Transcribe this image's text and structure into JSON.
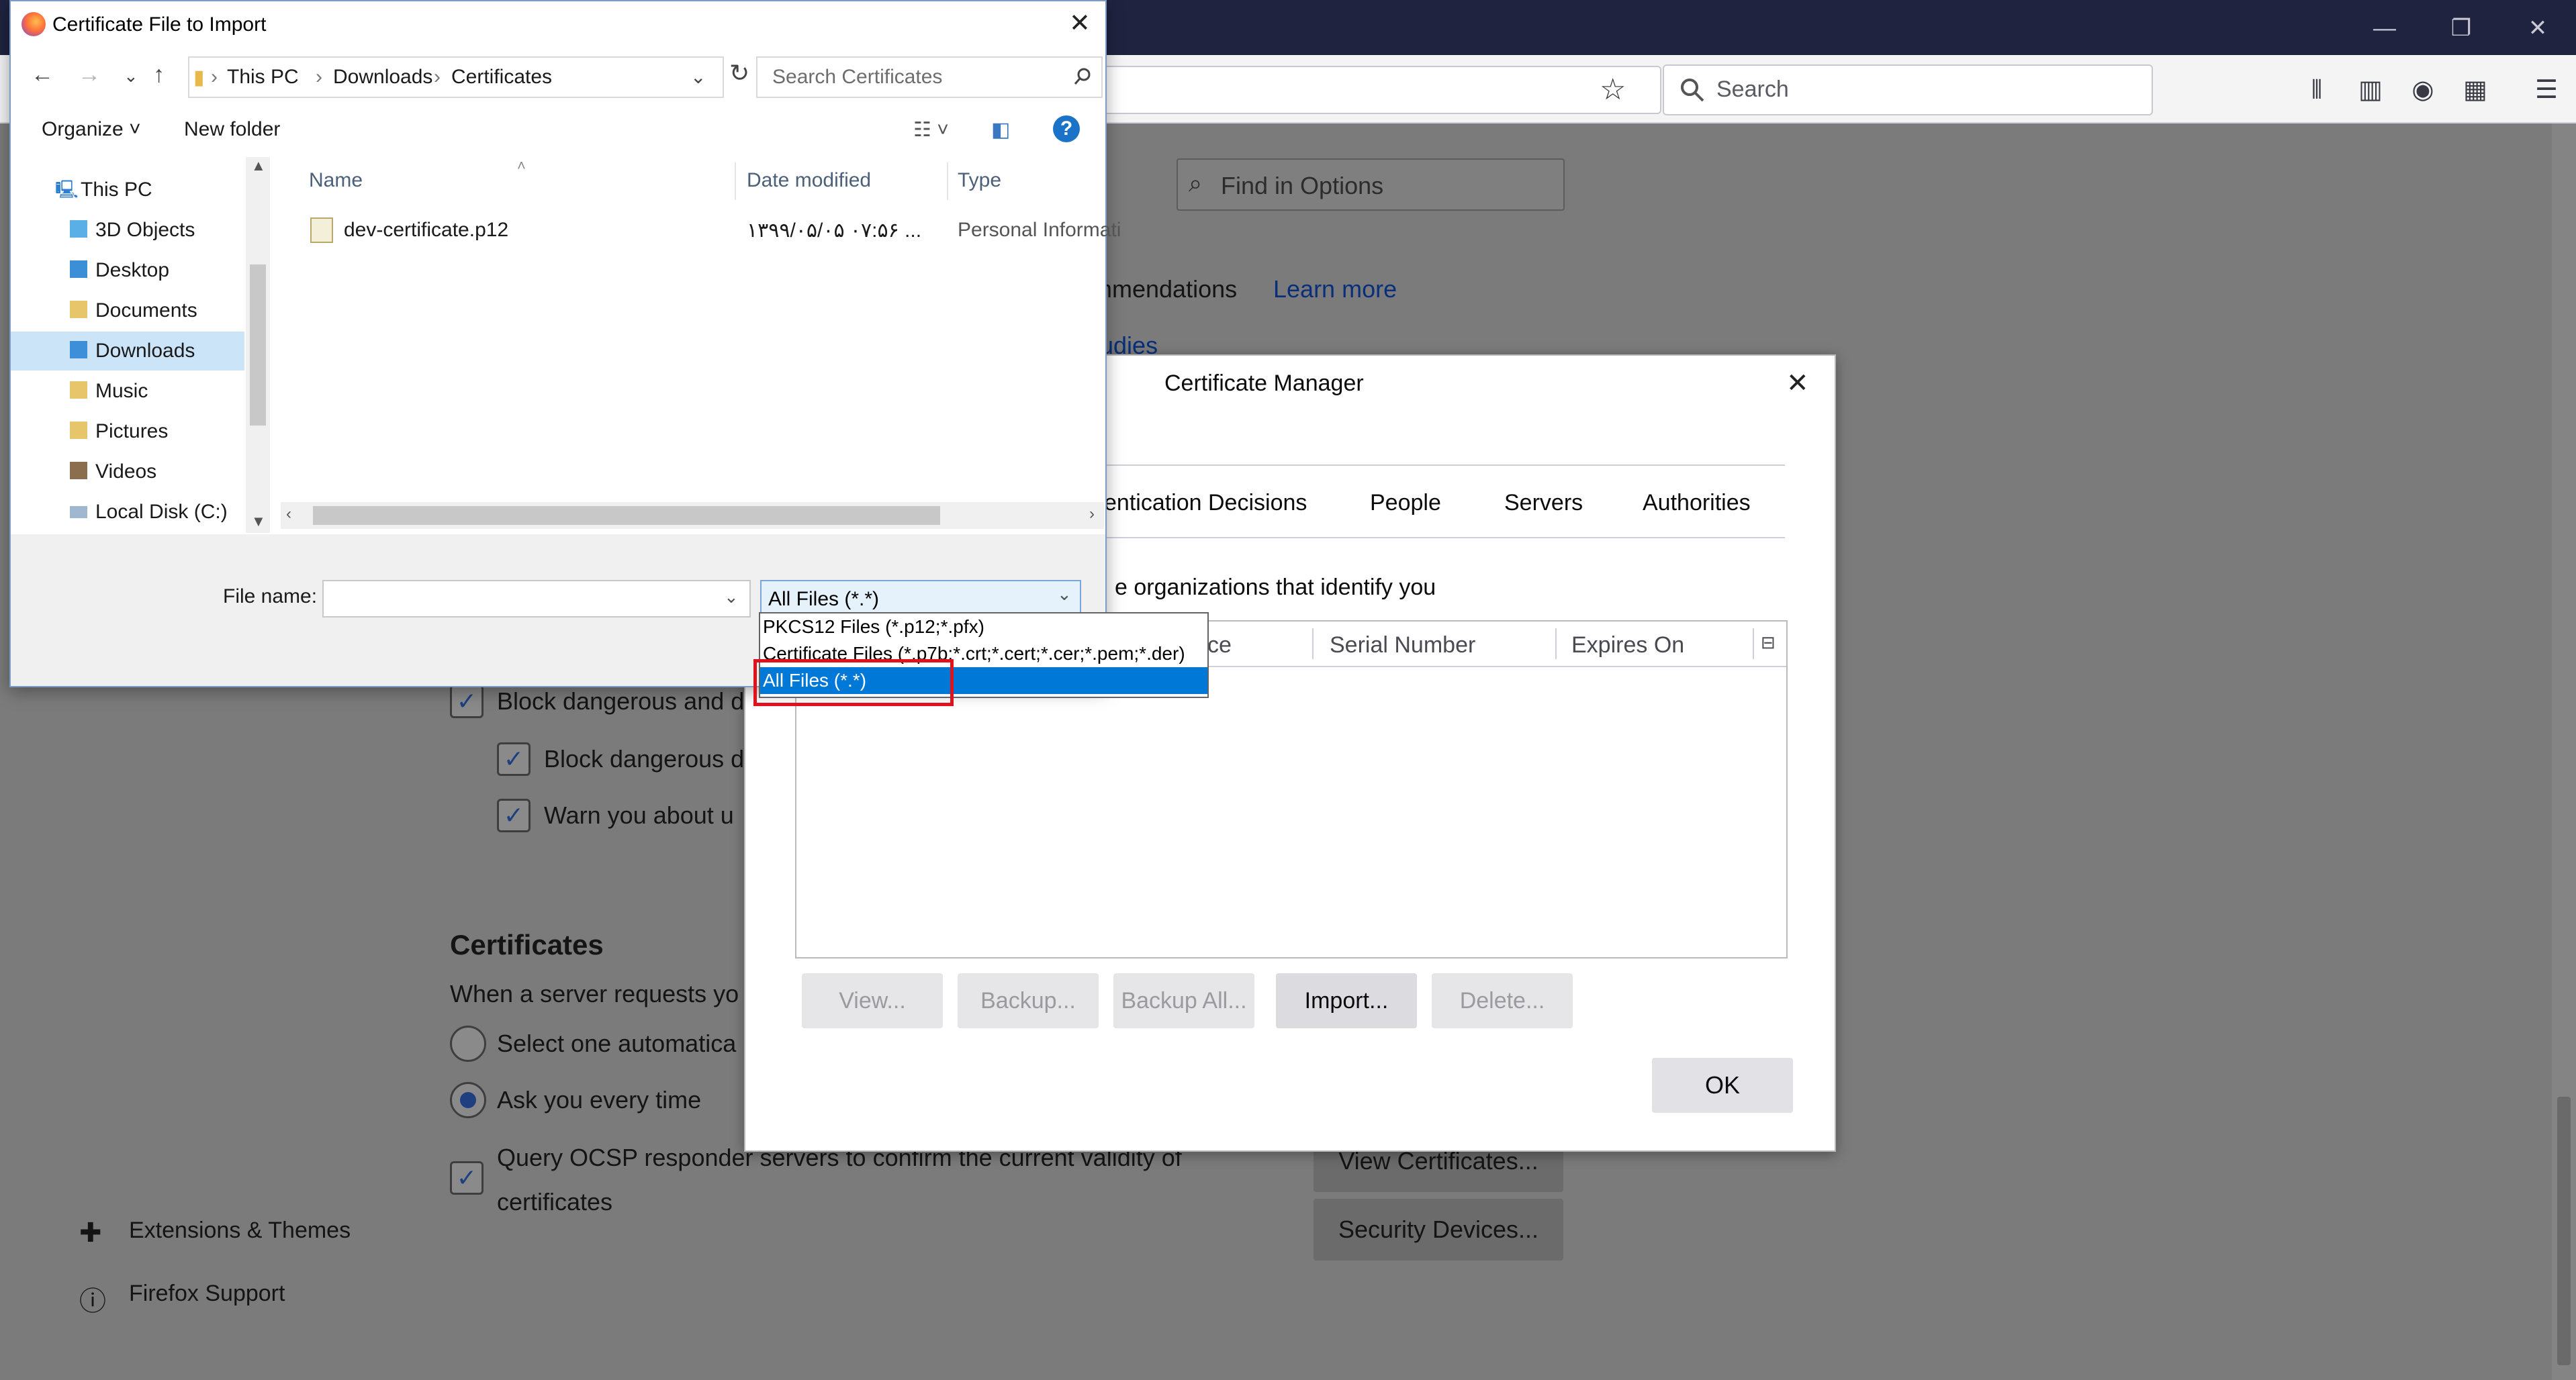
{
  "browser": {
    "search_placeholder": "Search",
    "window_controls": {
      "minimize": "—",
      "restore": "❐",
      "close": "✕"
    },
    "toolbar_icons": [
      "bookmark-star-icon",
      "library-icon",
      "sidebar-icon",
      "account-icon",
      "extensions-icon",
      "menu-icon"
    ]
  },
  "options": {
    "find_placeholder": "Find in Options",
    "recommendations_text": "mmendations",
    "learn_more": "Learn more",
    "studies_text": "udies",
    "block_dangerous_1": "Block dangerous and d",
    "block_dangerous_2": "Block dangerous d",
    "warn_you": "Warn you about u",
    "certificates_heading": "Certificates",
    "server_requests": "When a server requests yo",
    "select_one": "Select one automatica",
    "ask_every_time": "Ask you every time",
    "ocsp_line1": "Query OCSP responder servers to confirm the current validity of",
    "ocsp_line2": "certificates",
    "view_certificates": "View Certificates...",
    "security_devices": "Security Devices...",
    "extensions_themes": "Extensions & Themes",
    "firefox_support": "Firefox Support"
  },
  "cert_manager": {
    "title": "Certificate Manager",
    "tabs": [
      "entication Decisions",
      "People",
      "Servers",
      "Authorities"
    ],
    "description": "e organizations that identify you",
    "columns": [
      "ce",
      "Serial Number",
      "Expires On"
    ],
    "buttons": {
      "view": "View...",
      "backup": "Backup...",
      "backup_all": "Backup All...",
      "import": "Import...",
      "delete": "Delete..."
    },
    "ok": "OK"
  },
  "file_dialog": {
    "title": "Certificate File to Import",
    "breadcrumb": [
      "This PC",
      "Downloads",
      "Certificates"
    ],
    "search_placeholder": "Search Certificates",
    "organize": "Organize",
    "new_folder": "New folder",
    "help": "?",
    "tree": [
      {
        "label": "This PC",
        "icon": "computer-icon"
      },
      {
        "label": "3D Objects",
        "icon": "3d-objects-folder-icon"
      },
      {
        "label": "Desktop",
        "icon": "desktop-folder-icon"
      },
      {
        "label": "Documents",
        "icon": "documents-folder-icon"
      },
      {
        "label": "Downloads",
        "icon": "downloads-folder-icon",
        "selected": true
      },
      {
        "label": "Music",
        "icon": "music-folder-icon"
      },
      {
        "label": "Pictures",
        "icon": "pictures-folder-icon"
      },
      {
        "label": "Videos",
        "icon": "videos-folder-icon"
      },
      {
        "label": "Local Disk (C:)",
        "icon": "local-disk-icon"
      }
    ],
    "columns": [
      "Name",
      "Date modified",
      "Type"
    ],
    "files": [
      {
        "name": "dev-certificate.p12",
        "date": "۱۳۹۹/۰۵/۰۵ ۰۷:۵۶ ...",
        "type": "Personal Informati"
      }
    ],
    "file_name_label": "File name:",
    "file_name_value": "",
    "file_type_selected": "All Files (*.*)",
    "file_type_options": [
      "PKCS12 Files (*.p12;*.pfx)",
      "Certificate Files (*.p7b;*.crt;*.cert;*.cer;*.pem;*.der)",
      "All Files (*.*)"
    ]
  },
  "colors": {
    "titlebar": "#202340",
    "selection": "#0078d7",
    "highlight_box": "#e0131c",
    "link": "#0a2f7a"
  }
}
